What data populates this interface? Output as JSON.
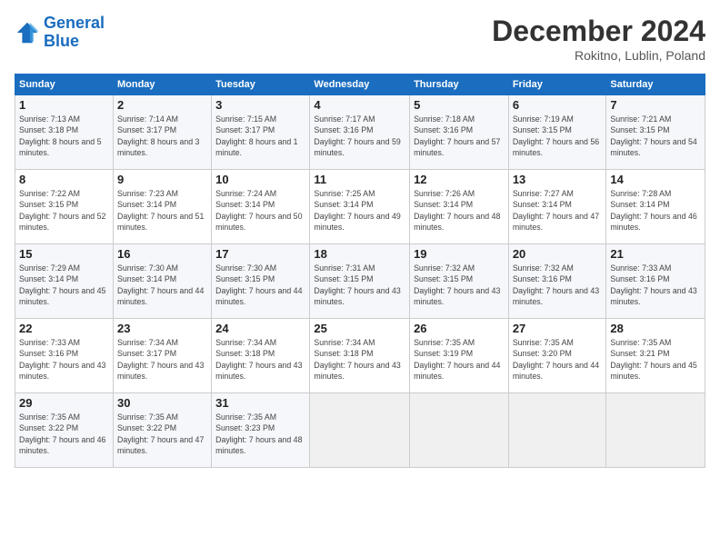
{
  "header": {
    "logo_line1": "General",
    "logo_line2": "Blue",
    "month": "December 2024",
    "location": "Rokitno, Lublin, Poland"
  },
  "weekdays": [
    "Sunday",
    "Monday",
    "Tuesday",
    "Wednesday",
    "Thursday",
    "Friday",
    "Saturday"
  ],
  "weeks": [
    [
      {
        "day": "1",
        "info": "Sunrise: 7:13 AM\nSunset: 3:18 PM\nDaylight: 8 hours and 5 minutes."
      },
      {
        "day": "2",
        "info": "Sunrise: 7:14 AM\nSunset: 3:17 PM\nDaylight: 8 hours and 3 minutes."
      },
      {
        "day": "3",
        "info": "Sunrise: 7:15 AM\nSunset: 3:17 PM\nDaylight: 8 hours and 1 minute."
      },
      {
        "day": "4",
        "info": "Sunrise: 7:17 AM\nSunset: 3:16 PM\nDaylight: 7 hours and 59 minutes."
      },
      {
        "day": "5",
        "info": "Sunrise: 7:18 AM\nSunset: 3:16 PM\nDaylight: 7 hours and 57 minutes."
      },
      {
        "day": "6",
        "info": "Sunrise: 7:19 AM\nSunset: 3:15 PM\nDaylight: 7 hours and 56 minutes."
      },
      {
        "day": "7",
        "info": "Sunrise: 7:21 AM\nSunset: 3:15 PM\nDaylight: 7 hours and 54 minutes."
      }
    ],
    [
      {
        "day": "8",
        "info": "Sunrise: 7:22 AM\nSunset: 3:15 PM\nDaylight: 7 hours and 52 minutes."
      },
      {
        "day": "9",
        "info": "Sunrise: 7:23 AM\nSunset: 3:14 PM\nDaylight: 7 hours and 51 minutes."
      },
      {
        "day": "10",
        "info": "Sunrise: 7:24 AM\nSunset: 3:14 PM\nDaylight: 7 hours and 50 minutes."
      },
      {
        "day": "11",
        "info": "Sunrise: 7:25 AM\nSunset: 3:14 PM\nDaylight: 7 hours and 49 minutes."
      },
      {
        "day": "12",
        "info": "Sunrise: 7:26 AM\nSunset: 3:14 PM\nDaylight: 7 hours and 48 minutes."
      },
      {
        "day": "13",
        "info": "Sunrise: 7:27 AM\nSunset: 3:14 PM\nDaylight: 7 hours and 47 minutes."
      },
      {
        "day": "14",
        "info": "Sunrise: 7:28 AM\nSunset: 3:14 PM\nDaylight: 7 hours and 46 minutes."
      }
    ],
    [
      {
        "day": "15",
        "info": "Sunrise: 7:29 AM\nSunset: 3:14 PM\nDaylight: 7 hours and 45 minutes."
      },
      {
        "day": "16",
        "info": "Sunrise: 7:30 AM\nSunset: 3:14 PM\nDaylight: 7 hours and 44 minutes."
      },
      {
        "day": "17",
        "info": "Sunrise: 7:30 AM\nSunset: 3:15 PM\nDaylight: 7 hours and 44 minutes."
      },
      {
        "day": "18",
        "info": "Sunrise: 7:31 AM\nSunset: 3:15 PM\nDaylight: 7 hours and 43 minutes."
      },
      {
        "day": "19",
        "info": "Sunrise: 7:32 AM\nSunset: 3:15 PM\nDaylight: 7 hours and 43 minutes."
      },
      {
        "day": "20",
        "info": "Sunrise: 7:32 AM\nSunset: 3:16 PM\nDaylight: 7 hours and 43 minutes."
      },
      {
        "day": "21",
        "info": "Sunrise: 7:33 AM\nSunset: 3:16 PM\nDaylight: 7 hours and 43 minutes."
      }
    ],
    [
      {
        "day": "22",
        "info": "Sunrise: 7:33 AM\nSunset: 3:16 PM\nDaylight: 7 hours and 43 minutes."
      },
      {
        "day": "23",
        "info": "Sunrise: 7:34 AM\nSunset: 3:17 PM\nDaylight: 7 hours and 43 minutes."
      },
      {
        "day": "24",
        "info": "Sunrise: 7:34 AM\nSunset: 3:18 PM\nDaylight: 7 hours and 43 minutes."
      },
      {
        "day": "25",
        "info": "Sunrise: 7:34 AM\nSunset: 3:18 PM\nDaylight: 7 hours and 43 minutes."
      },
      {
        "day": "26",
        "info": "Sunrise: 7:35 AM\nSunset: 3:19 PM\nDaylight: 7 hours and 44 minutes."
      },
      {
        "day": "27",
        "info": "Sunrise: 7:35 AM\nSunset: 3:20 PM\nDaylight: 7 hours and 44 minutes."
      },
      {
        "day": "28",
        "info": "Sunrise: 7:35 AM\nSunset: 3:21 PM\nDaylight: 7 hours and 45 minutes."
      }
    ],
    [
      {
        "day": "29",
        "info": "Sunrise: 7:35 AM\nSunset: 3:22 PM\nDaylight: 7 hours and 46 minutes."
      },
      {
        "day": "30",
        "info": "Sunrise: 7:35 AM\nSunset: 3:22 PM\nDaylight: 7 hours and 47 minutes."
      },
      {
        "day": "31",
        "info": "Sunrise: 7:35 AM\nSunset: 3:23 PM\nDaylight: 7 hours and 48 minutes."
      },
      null,
      null,
      null,
      null
    ]
  ]
}
